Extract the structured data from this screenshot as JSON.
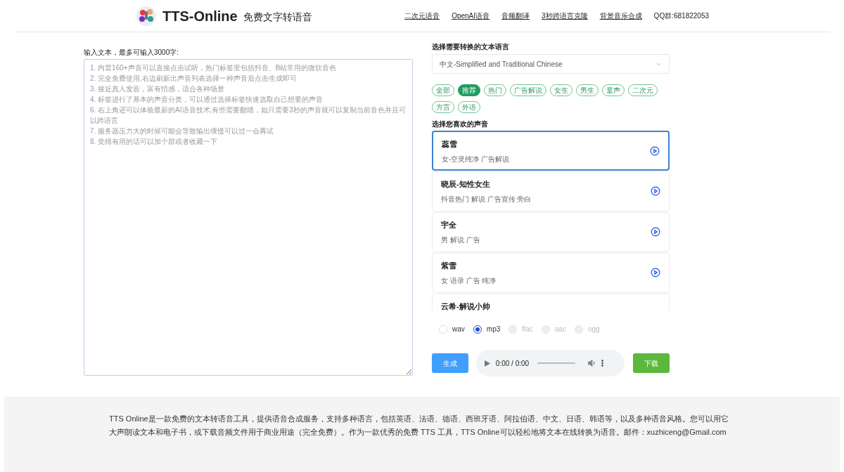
{
  "header": {
    "brand": "TTS-Online",
    "tagline": "免费文字转语音",
    "nav": [
      {
        "label": "二次元语音"
      },
      {
        "label": "OpenAI语音"
      },
      {
        "label": "音频翻译"
      },
      {
        "label": "3秒跨语言克隆"
      },
      {
        "label": "背景音乐合成"
      }
    ],
    "qq": "QQ群:681822053"
  },
  "input": {
    "label": "输入文本，最多可输入3000字:",
    "placeholder": "1. 内置160+声音可以直接点击试听，热门标签里包括抖音、B站常用的微软音色\n2. 完全免费使用,右边刷新出声音列表选择一种声音后点击生成即可\n3. 接近真人发音，富有情感，适合各种场景\n4. 标签进行了基本的声音分类，可以通过选择标签快速选取自己想要的声音\n6. 右上角还可以体验最新的AI语音技术,有些需要翻墙，如只需要3秒的声音就可以复制当前音色并且可以跨语言\n7. 服务器压力大的时候可能会导致输出缓慢可以过一会再试\n8. 觉得有用的话可以加个群或者收藏一下"
  },
  "language": {
    "label": "选择需要转换的文本语言",
    "value": "中文-Simplified and Traditional Chinese"
  },
  "tags": [
    {
      "label": "全部",
      "selected": false
    },
    {
      "label": "推荐",
      "selected": true
    },
    {
      "label": "热门",
      "selected": false
    },
    {
      "label": "广告解说",
      "selected": false
    },
    {
      "label": "女生",
      "selected": false
    },
    {
      "label": "男生",
      "selected": false
    },
    {
      "label": "童声",
      "selected": false
    },
    {
      "label": "二次元",
      "selected": false
    },
    {
      "label": "方言",
      "selected": false
    },
    {
      "label": "外语",
      "selected": false
    }
  ],
  "voices_label": "选择您喜欢的声音",
  "voices": [
    {
      "name": "蕊雪",
      "desc": "女-空灵纯净 广告解说",
      "selected": true
    },
    {
      "name": "晓辰-知性女生",
      "desc": "抖音热门 解说 广告宣传 旁白",
      "selected": false
    },
    {
      "name": "宇全",
      "desc": "男 解说 广告",
      "selected": false
    },
    {
      "name": "紫雪",
      "desc": "女 语录 广告 纯净",
      "selected": false
    },
    {
      "name": "云希-解说小帅",
      "selected": false
    }
  ],
  "formats": [
    {
      "label": "wav",
      "selected": false,
      "disabled": false
    },
    {
      "label": "mp3",
      "selected": true,
      "disabled": false
    },
    {
      "label": "flac",
      "selected": false,
      "disabled": true
    },
    {
      "label": "aac",
      "selected": false,
      "disabled": true
    },
    {
      "label": "ogg",
      "selected": false,
      "disabled": true
    }
  ],
  "generate_button": "生成",
  "player": {
    "time": "0:00 / 0:00"
  },
  "download_button": "下载",
  "footer": {
    "text": "TTS Online是一款免费的文本转语音工具，提供语音合成服务，支持多种语言，包括英语、法语、德语、西班牙语、阿拉伯语、中文、日语、韩语等，以及多种语音风格。您可以用它大声朗读文本和电子书，或下载音频文件用于商业用途（完全免费）。作为一款优秀的免费 TTS 工具，TTS Online可以轻松地将文本在线转换为语音。邮件：xuzhiceng@Gmail.com"
  }
}
